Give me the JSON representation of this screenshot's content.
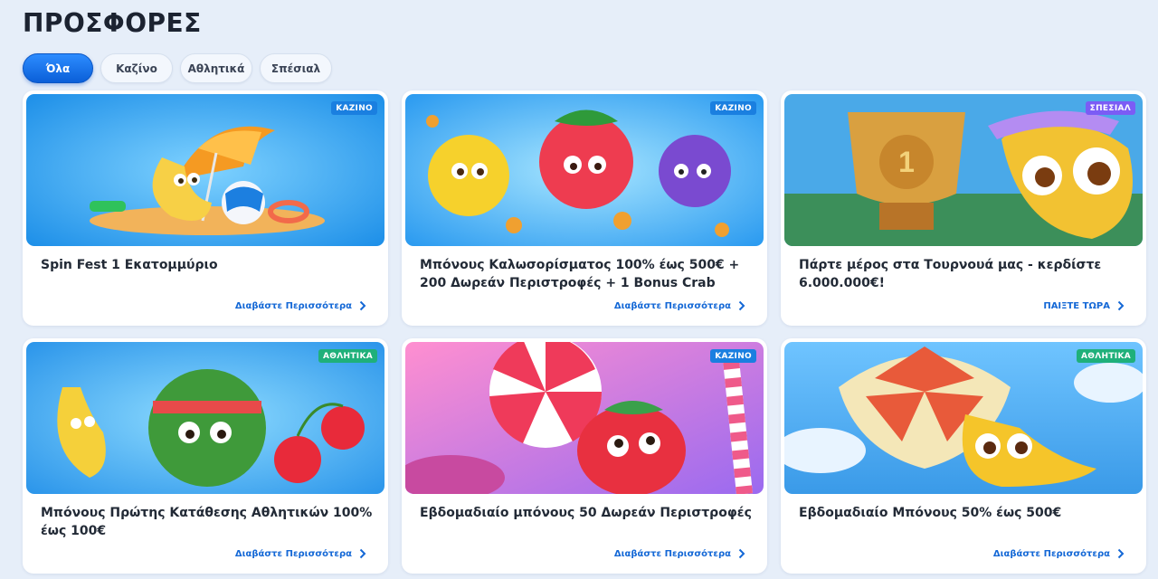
{
  "page": {
    "title": "ΠΡΟΣΦΟΡΕΣ"
  },
  "filters": [
    {
      "label": "Όλα",
      "active": true
    },
    {
      "label": "Καζίνο",
      "active": false
    },
    {
      "label": "Αθλητικά",
      "active": false
    },
    {
      "label": "Σπέσιαλ",
      "active": false
    }
  ],
  "cards": [
    {
      "badge": "ΚΑΖΙΝΟ",
      "title": "Spin Fest 1 Εκατομμύριο",
      "link": "Διαβάστε Περισσότερα",
      "image_icon": "banana-umbrella-beach-image"
    },
    {
      "badge": "ΚΑΖΙΝΟ",
      "title": "Μπόνους Καλωσορίσματος 100% έως 500€ + 200 Δωρεάν Περιστροφές + 1 Bonus Crab",
      "link": "Διαβάστε Περισσότερα",
      "image_icon": "fruits-coins-image"
    },
    {
      "badge": "ΣΠΕΣΙΑΛ",
      "title": "Πάρτε μέρος στα Τουρνουά μας - κερδίστε 6.000.000€!",
      "link": "ΠΑΙΞΤΕ ΤΩΡΑ",
      "image_icon": "trophy-banana-image"
    },
    {
      "badge": "ΑΘΛΗΤΙΚΑ",
      "title": "Μπόνους Πρώτης Κατάθεσης Αθλητικών 100% έως 100€",
      "link": "Διαβάστε Περισσότερα",
      "image_icon": "watermelon-cherries-image"
    },
    {
      "badge": "ΚΑΖΙΝΟ",
      "title": "Εβδομαδιαίο μπόνους 50 Δωρεάν Περιστροφές",
      "link": "Διαβάστε Περισσότερα",
      "image_icon": "candy-strawberry-image"
    },
    {
      "badge": "ΑΘΛΗΤΙΚΑ",
      "title": "Εβδομαδιαίο Μπόνους 50% έως 500€",
      "link": "Διαβάστε Περισσότερα",
      "image_icon": "parachute-banana-image"
    }
  ],
  "colors": {
    "accent": "#1468d6",
    "casino_badge": "#1a7fe0",
    "special_badge": "#7b5cf5",
    "sports_badge": "#1fb07a",
    "background": "#e6eef9"
  }
}
